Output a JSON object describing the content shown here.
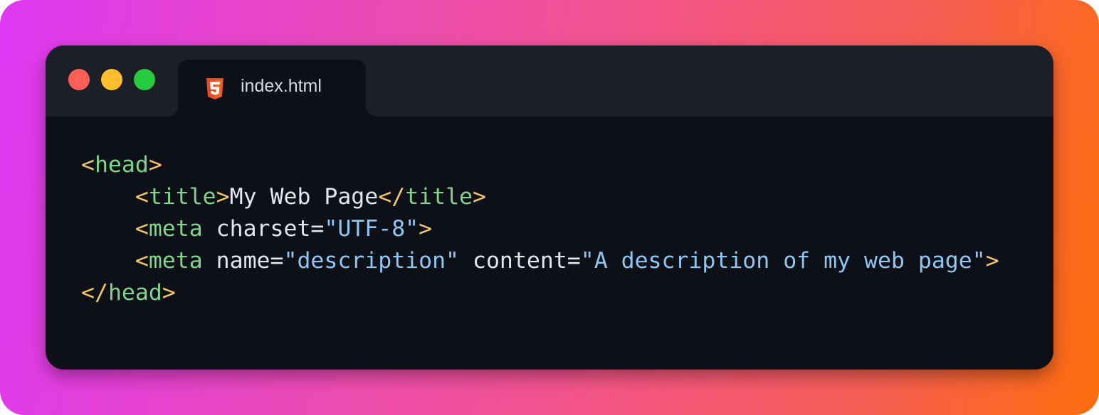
{
  "colors": {
    "tag": "#7fd68b",
    "punctuation": "#f2c76a",
    "string": "#8ec6f4",
    "text": "#e2e6ee",
    "editor_background": "#0d1017",
    "titlebar_background": "#1c1f28"
  },
  "window": {
    "buttons": [
      "close",
      "minimize",
      "maximize"
    ]
  },
  "tab": {
    "icon": "html5-icon",
    "label": "index.html"
  },
  "code_lines": [
    [
      {
        "t": "punct",
        "v": "<"
      },
      {
        "t": "tag",
        "v": "head"
      },
      {
        "t": "punct",
        "v": ">"
      }
    ],
    [
      {
        "t": "text",
        "v": "    "
      },
      {
        "t": "punct",
        "v": "<"
      },
      {
        "t": "tag",
        "v": "title"
      },
      {
        "t": "punct",
        "v": ">"
      },
      {
        "t": "text",
        "v": "My Web Page"
      },
      {
        "t": "punct",
        "v": "</"
      },
      {
        "t": "tag",
        "v": "title"
      },
      {
        "t": "punct",
        "v": ">"
      }
    ],
    [
      {
        "t": "text",
        "v": "    "
      },
      {
        "t": "punct",
        "v": "<"
      },
      {
        "t": "tag",
        "v": "meta"
      },
      {
        "t": "text",
        "v": " "
      },
      {
        "t": "attr",
        "v": "charset"
      },
      {
        "t": "attr",
        "v": "="
      },
      {
        "t": "str",
        "v": "\"UTF-8\""
      },
      {
        "t": "punct",
        "v": ">"
      }
    ],
    [
      {
        "t": "text",
        "v": "    "
      },
      {
        "t": "punct",
        "v": "<"
      },
      {
        "t": "tag",
        "v": "meta"
      },
      {
        "t": "text",
        "v": " "
      },
      {
        "t": "attr",
        "v": "name"
      },
      {
        "t": "attr",
        "v": "="
      },
      {
        "t": "str",
        "v": "\"description\""
      },
      {
        "t": "text",
        "v": " "
      },
      {
        "t": "attr",
        "v": "content"
      },
      {
        "t": "attr",
        "v": "="
      },
      {
        "t": "str",
        "v": "\"A description of my web page\""
      },
      {
        "t": "punct",
        "v": ">"
      }
    ],
    [
      {
        "t": "punct",
        "v": "</"
      },
      {
        "t": "tag",
        "v": "head"
      },
      {
        "t": "punct",
        "v": ">"
      }
    ]
  ]
}
